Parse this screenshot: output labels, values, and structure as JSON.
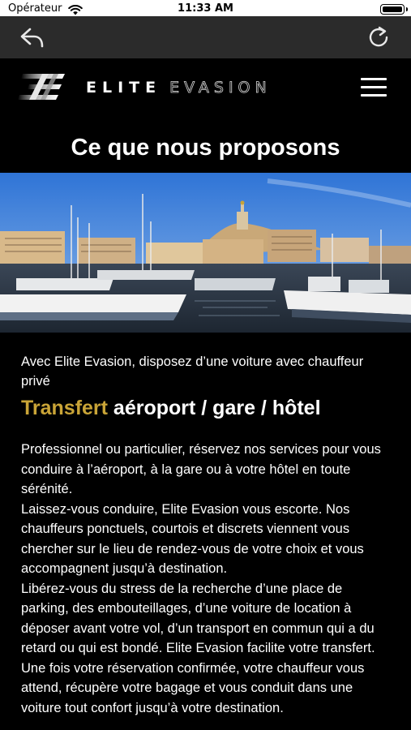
{
  "status_bar": {
    "carrier": "Opérateur",
    "time": "11:33 AM"
  },
  "toolbar": {
    "back_icon": "back-arrow-icon",
    "reload_icon": "reload-icon"
  },
  "header": {
    "logo_elite": "ELITE",
    "logo_evasion": "EVASION",
    "menu_icon": "hamburger-menu-icon"
  },
  "page": {
    "title": "Ce que nous proposons",
    "intro": "Avec Elite Evasion, disposez d’une voiture avec chauffeur privé",
    "heading_highlight": "Transfert",
    "heading_rest": " aéroport / gare / hôtel",
    "paragraphs": [
      "Professionnel ou particulier, réservez nos services pour vous conduire à l’aéroport, à la gare ou à votre hôtel en toute sérénité.",
      "Laissez-vous conduire, Elite Evasion vous escorte. Nos chauffeurs ponctuels, courtois et discrets viennent vous chercher sur le lieu de rendez-vous de votre choix et vous accompagnent jusqu’à destination.",
      "Libérez-vous du stress de la recherche d’une place de parking, des embouteillages, d’une voiture de location à déposer avant votre vol, d’un transport en commun qui a du retard ou qui est bondé. Elite Evasion facilite votre transfert. Une fois votre réservation confirmée, votre chauffeur vous attend, récupère votre bagage et vous conduit dans une voiture tout confort jusqu’à votre destination."
    ]
  },
  "colors": {
    "toolbar_bg": "#2b2b2b",
    "page_bg": "#000000",
    "accent_gold": "#c9a437"
  }
}
